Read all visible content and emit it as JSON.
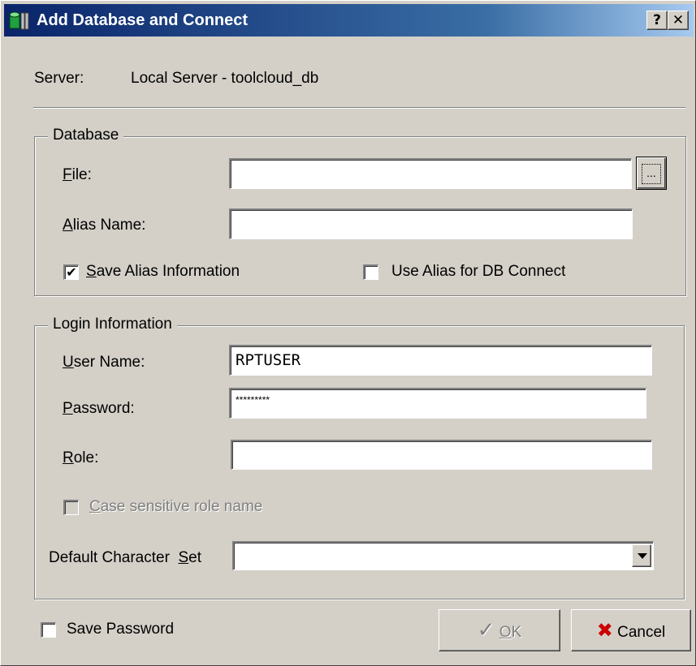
{
  "window": {
    "title": "Add Database and Connect",
    "help_glyph": "?",
    "close_glyph": "✕"
  },
  "server": {
    "label": "Server:",
    "value": "Local Server - toolcloud_db"
  },
  "database_group": {
    "legend": "Database",
    "file_label_first": "F",
    "file_label_rest": "ile:",
    "file_value": "",
    "browse_glyph": "...",
    "alias_label_first": "A",
    "alias_label_rest": "lias Name:",
    "alias_value": "",
    "save_alias": {
      "first": "S",
      "rest": "ave Alias Information",
      "checked": true
    },
    "use_alias": {
      "label": "Use Alias for DB Connect",
      "checked": false
    }
  },
  "login_group": {
    "legend": "Login Information",
    "user_label_first": "U",
    "user_label_rest": "ser Name:",
    "user_value": "RPTUSER",
    "password_label_first": "P",
    "password_label_rest": "assword:",
    "password_value": "*********",
    "role_label_first": "R",
    "role_label_rest": "ole:",
    "role_value": "",
    "case_sensitive": {
      "first": "C",
      "rest": "ase sensitive role name",
      "checked": false,
      "enabled": false
    },
    "charset_label_before": "Default Character  ",
    "charset_label_first": "S",
    "charset_label_rest": "et",
    "charset_value": ""
  },
  "footer": {
    "save_password": {
      "label": "Save Password",
      "checked": false
    },
    "ok": {
      "icon_glyph": "✓",
      "first": "O",
      "rest": "K",
      "enabled": false
    },
    "cancel": {
      "icon_glyph": "✖",
      "label": "Cancel",
      "icon_color": "#cc0000"
    }
  },
  "colors": {
    "title_gradient_start": "#0a246a",
    "title_gradient_end": "#a6caf0",
    "face": "#d4d0c8"
  }
}
